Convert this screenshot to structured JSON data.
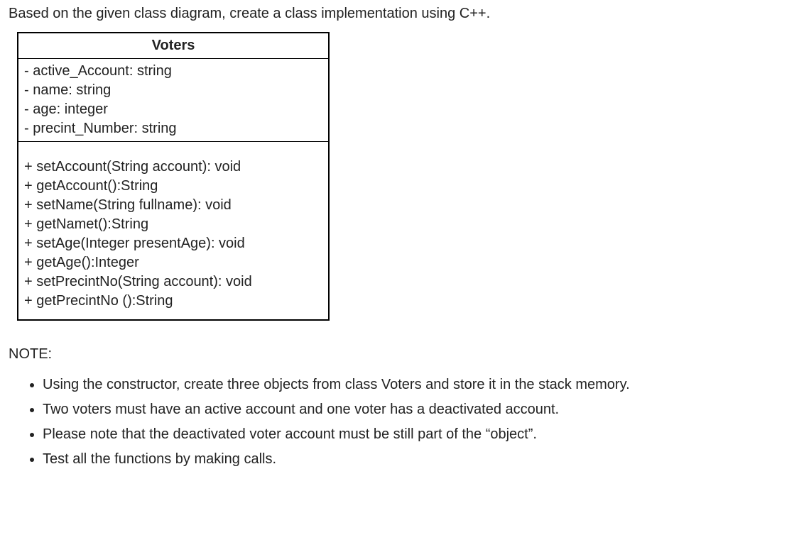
{
  "instruction": "Based on the given class diagram, create a class implementation using C++.",
  "uml": {
    "class_name": "Voters",
    "attributes": [
      "- active_Account: string",
      "- name: string",
      "- age: integer",
      "- precint_Number: string"
    ],
    "methods": [
      "+ setAccount(String account): void",
      "+ getAccount():String",
      "+ setName(String fullname): void",
      "+ getNamet():String",
      "+ setAge(Integer presentAge): void",
      "+ getAge():Integer",
      "+ setPrecintNo(String account): void",
      "+ getPrecintNo ():String"
    ]
  },
  "note_heading": "NOTE:",
  "notes": [
    "Using the constructor, create three objects from class Voters and store it in the stack memory.",
    "Two voters must have an active account and one voter has a deactivated account.",
    "Please note that the deactivated voter account must be still part of the “object”.",
    "Test all the functions by making calls."
  ]
}
